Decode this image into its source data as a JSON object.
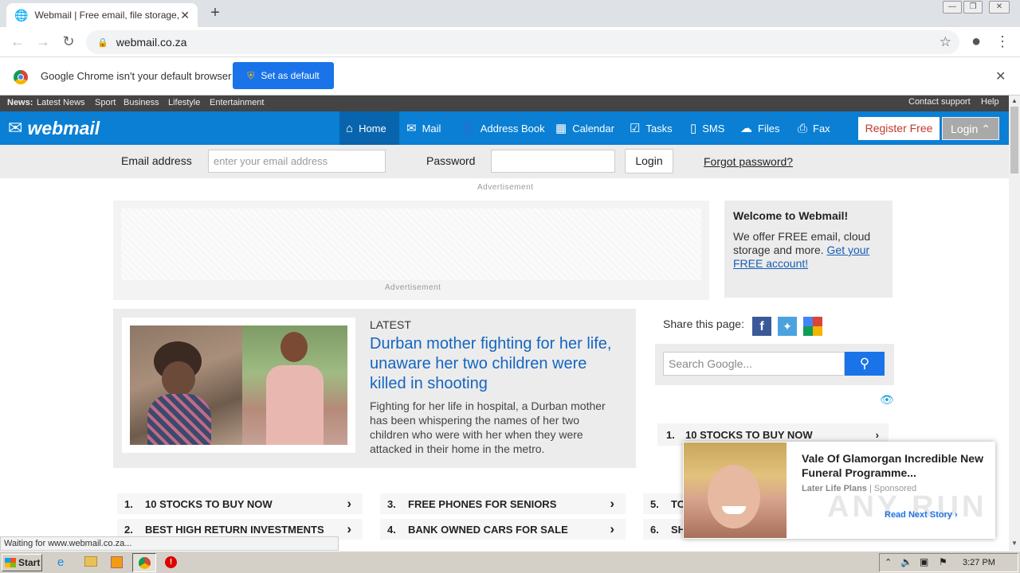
{
  "browser": {
    "tab_title": "Webmail | Free email, file storage, s",
    "url": "webmail.co.za",
    "infobar_text": "Google Chrome isn't your default browser",
    "set_default_label": "Set as default"
  },
  "newsbar": {
    "prefix": "News:",
    "items": [
      "Latest News",
      "Sport",
      "Business",
      "Lifestyle",
      "Entertainment"
    ],
    "right": [
      "Contact support",
      "Help"
    ]
  },
  "nav": {
    "logo": "webmail",
    "items": [
      "Home",
      "Mail",
      "Address Book",
      "Calendar",
      "Tasks",
      "SMS",
      "Files",
      "Fax"
    ],
    "register": "Register Free",
    "login": "Login"
  },
  "login_row": {
    "email_label": "Email address",
    "email_placeholder": "enter your email address",
    "password_label": "Password",
    "login_button": "Login",
    "forgot": "Forgot password?"
  },
  "ads": {
    "top_label": "Advertisement",
    "inner_label": "Advertisement"
  },
  "welcome": {
    "title": "Welcome to Webmail!",
    "text": "We offer FREE email, cloud storage and more.",
    "link": "Get your FREE account!"
  },
  "article": {
    "tag": "LATEST",
    "headline": "Durban mother fighting for her life, unaware her two children were killed in shooting",
    "summary": "Fighting for her life in hospital, a Durban mother has been whispering the names of her two children who were with her when they were attacked in their home in the metro."
  },
  "share": {
    "label": "Share this page:",
    "search_placeholder": "Search Google..."
  },
  "sidebar_list": {
    "num": "1.",
    "text": "10 STOCKS TO BUY NOW"
  },
  "lists": [
    {
      "num": "1.",
      "text": "10 STOCKS TO BUY NOW"
    },
    {
      "num": "3.",
      "text": "FREE PHONES FOR SENIORS"
    },
    {
      "num": "5.",
      "text": "TO"
    },
    {
      "num": "2.",
      "text": "BEST HIGH RETURN INVESTMENTS"
    },
    {
      "num": "4.",
      "text": "BANK OWNED CARS FOR SALE"
    },
    {
      "num": "6.",
      "text": "SH"
    }
  ],
  "popup": {
    "headline": "Vale Of Glamorgan Incredible New Funeral Programme...",
    "source": "Later Life Plans",
    "sponsored": "Sponsored",
    "cta": "Read Next Story ›"
  },
  "status": "Waiting for www.webmail.co.za...",
  "taskbar": {
    "start": "Start",
    "time": "3:27 PM"
  },
  "watermark": "ANY RUN"
}
